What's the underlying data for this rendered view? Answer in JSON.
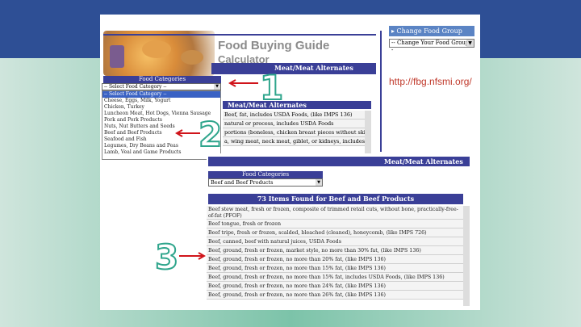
{
  "header": {
    "title": "Food Buying Guide",
    "subtitle": "Calculator",
    "category_bar": "Meat/Meat Alternates"
  },
  "sidebar": {
    "change_group_label": "▸ Change Food Group",
    "change_select_value": "-- Change Your Food Group --"
  },
  "url": "http://fbg.nfsmi.org/",
  "steps": [
    "1",
    "2",
    "3"
  ],
  "dropdown": {
    "header": "Food Categories",
    "selected_value": "-- Select Food Category --",
    "options": [
      "-- Select Food Category --",
      "Cheese, Eggs, Milk, Yogurt",
      "Chicken, Turkey",
      "Luncheon Meat, Hot Dogs, Vienna Sausage",
      "Pork and Pork Products",
      "Nuts, Nut Butters and Seeds",
      "Beef and Beef Products",
      "Seafood and Fish",
      "Legumes, Dry Beans and Peas",
      "Lamb, Veal and Game Products"
    ]
  },
  "background_list": {
    "header": "Meat/Meat Alternates",
    "rows": [
      "Beef, fat, includes USDA Foods, (like IMPS 136)",
      "natural or process, includes USDA Foods",
      "portions (boneless, chicken breast pieces without skin)",
      "a, wing meat, neck meat, giblet, or kidneys, includes"
    ]
  },
  "results": {
    "category_bar": "Meat/Meat Alternates",
    "dropdown_header": "Food Categories",
    "selected_value": "Beef and Beef Products",
    "count_title": "73 Items Found for Beef and Beef Products",
    "rows": [
      "Beef stew meat, fresh or frozen, composite of trimmed retail cuts, without bone, practically-free-of-fat (PFOF)",
      "Beef tongue, fresh or frozen",
      "Beef tripe, fresh or frozen, scalded, bleached (cleaned), honeycomb, (like IMPS 726)",
      "Beef, canned, beef with natural juices, USDA Foods",
      "Beef, ground, fresh or frozen, market style, no more than 30% fat, (like IMPS 136)",
      "Beef, ground, fresh or frozen, no more than 20% fat, (like IMPS 136)",
      "Beef, ground, fresh or frozen, no more than 15% fat, (like IMPS 136)",
      "Beef, ground, fresh or frozen, no more than 15% fat, includes USDA Foods, (like IMPS 136)",
      "Beef, ground, fresh or frozen, no more than 24% fat, (like IMPS 136)",
      "Beef, ground, fresh or frozen, no more than 26% fat, (like IMPS 136)"
    ]
  }
}
